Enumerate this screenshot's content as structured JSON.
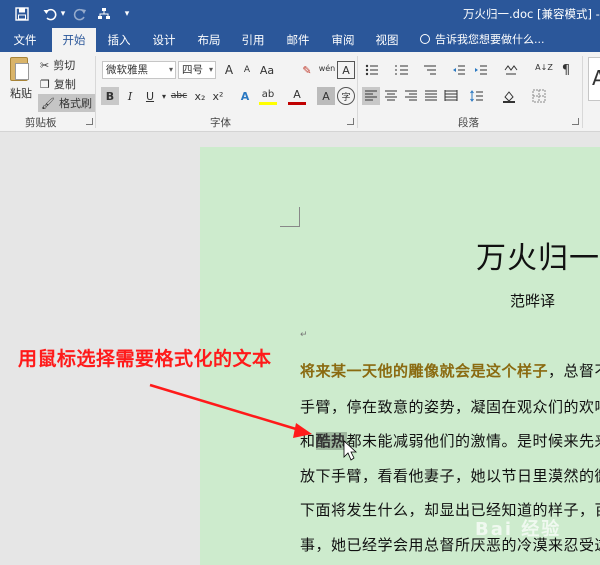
{
  "window": {
    "title": "万火归一.doc [兼容模式] - Wo"
  },
  "quick_access": {
    "undo_dropdown": "▾",
    "customize": "▾"
  },
  "tabs": [
    {
      "label": "文件"
    },
    {
      "label": "开始"
    },
    {
      "label": "插入"
    },
    {
      "label": "设计"
    },
    {
      "label": "布局"
    },
    {
      "label": "引用"
    },
    {
      "label": "邮件"
    },
    {
      "label": "审阅"
    },
    {
      "label": "视图"
    }
  ],
  "tell_me": "告诉我您想要做什么...",
  "clipboard": {
    "paste": "粘贴",
    "cut": "剪切",
    "copy": "复制",
    "format_painter": "格式刷",
    "group_label": "剪贴板"
  },
  "font": {
    "font_name": "微软雅黑",
    "font_size": "四号",
    "grow": "A",
    "shrink": "A",
    "change_case": "Aa",
    "phonetic": "wén",
    "char_border": "A",
    "bold": "B",
    "italic": "I",
    "underline": "U",
    "strikethrough": "abc",
    "subscript": "x₂",
    "superscript": "x²",
    "text_effects": "A",
    "highlight": "ab",
    "font_color": "A",
    "char_shading": "A",
    "enclose": "字",
    "group_label": "字体"
  },
  "paragraph": {
    "group_label": "段落",
    "sort": "A↓Z"
  },
  "styles": {
    "preview": "A"
  },
  "document": {
    "heading": "万火归一",
    "author": "范晔译",
    "para_mark": "↵",
    "lines": [
      {
        "highlight": "将来某一天他的雕像就会是这个样子",
        "rest": "，总督不"
      },
      {
        "text": "手臂，停在致意的姿势，凝固在观众们的欢呼"
      },
      {
        "before": "和",
        "selected": "酷热",
        "rest": "都未能减弱他们的激情。是时候来先来"
      },
      {
        "text": "放下手臂，看看他妻子，她以节日里漠然的微"
      },
      {
        "text": "下面将发生什么，却显出已经知道的样子，百"
      },
      {
        "text": "事，她已经学会用总督所厌恶的冷漠来忍受这"
      }
    ]
  },
  "annotation": {
    "text": "用鼠标选择需要格式化的文本",
    "color": "#ff1a1a"
  },
  "watermark": "Bai 经验",
  "colors": {
    "title_bar": "#2b579a",
    "page_background": "#cdebcd",
    "selection": "#9fb89f"
  }
}
